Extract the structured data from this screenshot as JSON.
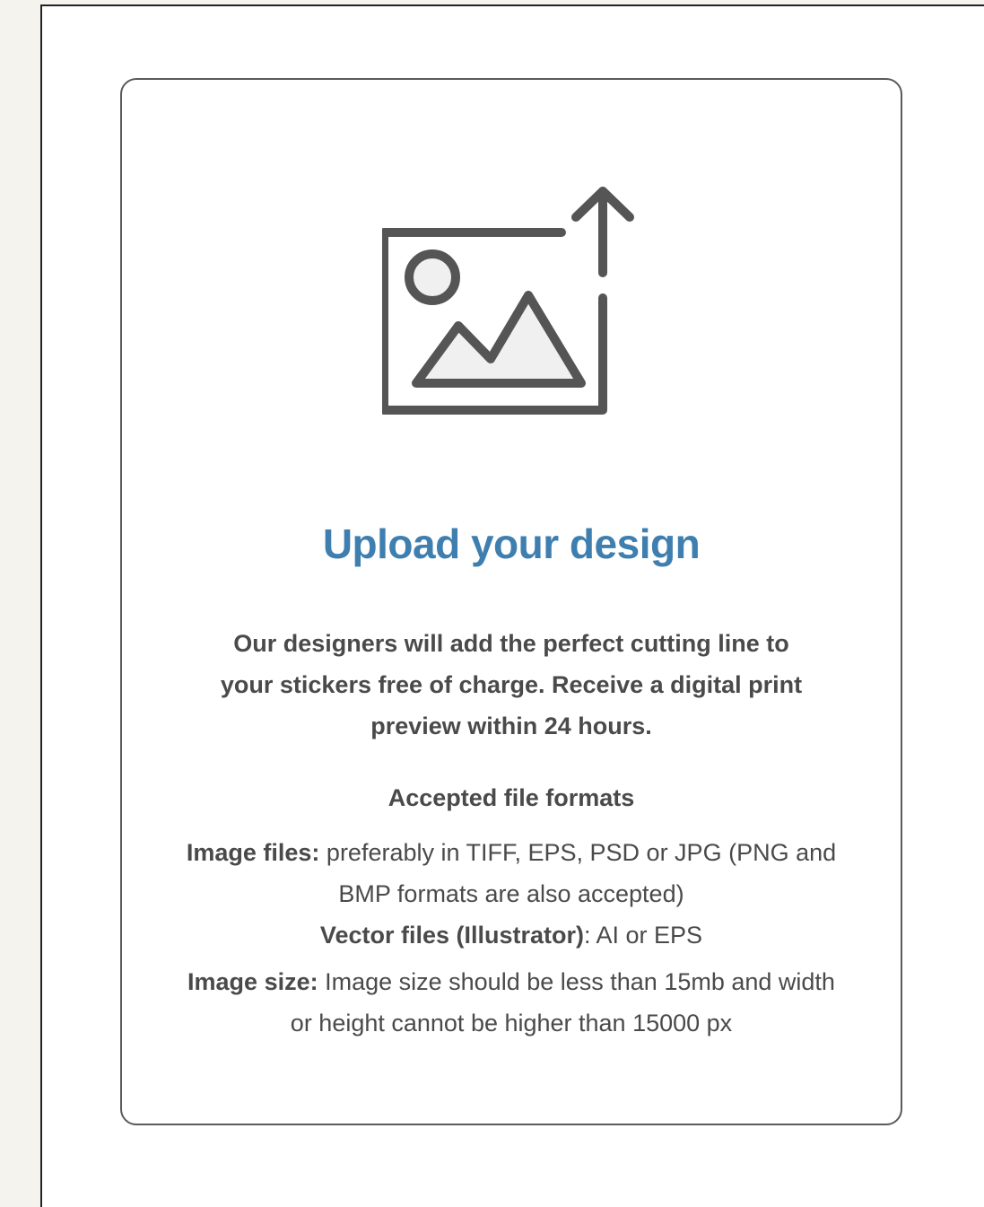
{
  "upload": {
    "title": "Upload your design",
    "description": "Our designers will add the perfect cutting line to your stickers free of charge. Receive a digital print preview within 24 hours.",
    "formats_heading": "Accepted file formats",
    "image_files_label": "Image files:",
    "image_files_text": " preferably in TIFF, EPS, PSD or JPG (PNG and BMP formats are also accepted)",
    "vector_files_label": "Vector files (Illustrator)",
    "vector_files_text": ": AI or EPS",
    "image_size_label": "Image size:",
    "image_size_text": " Image size should be less than 15mb and width or height cannot be higher than 15000 px"
  },
  "icons": {
    "illustration": "image-upload-icon"
  },
  "colors": {
    "title": "#3f7fb0",
    "text": "#4a4a4a",
    "icon_stroke": "#555555",
    "icon_fill": "#f0f0f0"
  }
}
